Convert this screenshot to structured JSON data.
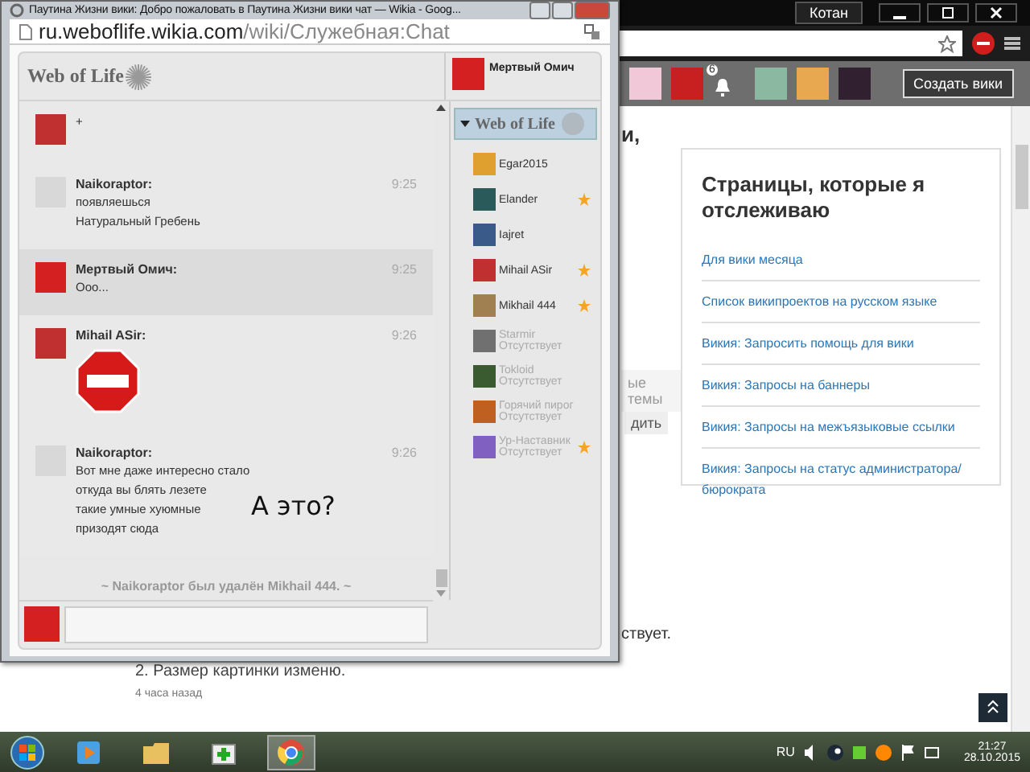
{
  "background_browser": {
    "profile_name": "Котан",
    "header_button": "Создать вики",
    "notification_count": "6",
    "fragments": [
      {
        "kind": "heading",
        "text": "и,"
      },
      {
        "kind": "tab",
        "text": "ые темы"
      },
      {
        "kind": "button",
        "text": "дить"
      },
      {
        "kind": "text",
        "text": "ствует."
      }
    ],
    "comment": {
      "text": "2. Размер картинки изменю.",
      "time": "4 часа назад"
    },
    "watchlist": {
      "title": "Страницы, которые я отслеживаю",
      "links": [
        "Для вики месяца",
        "Список википроектов на русском языке",
        "Викия: Запросить помощь для вики",
        "Викия: Запросы на баннеры",
        "Викия: Запросы на межъязыковые ссылки",
        "Викия: Запросы на статус администратора/ бюрократа"
      ]
    }
  },
  "chat_window": {
    "title": "Паутина Жизни вики: Добро пожаловать в Паутина Жизни вики чат — Wikia - Goog...",
    "url_host": "ru.weboflife.wikia.com",
    "url_path": "/wiki/Служебная:Chat",
    "logo": "Web of Life",
    "current_user": "Мертвый Омич",
    "messages": [
      {
        "kind": "text",
        "lines": [
          "+"
        ],
        "highlighted": false,
        "color": "#c03030"
      },
      {
        "kind": "text",
        "user": "Naikoraptor:",
        "time": "9:25",
        "lines": [
          "появляешься",
          "Натуральный Гребень"
        ],
        "highlighted": false,
        "color": "#d8d8d8"
      },
      {
        "kind": "text",
        "user": "Мертвый Омич:",
        "time": "9:25",
        "lines": [
          "Ооо..."
        ],
        "highlighted": true,
        "color": "#d42020"
      },
      {
        "kind": "image",
        "user": "Mihail ASir:",
        "time": "9:26",
        "highlighted": false,
        "color": "#c03030"
      },
      {
        "kind": "text",
        "user": "Naikoraptor:",
        "time": "9:26",
        "lines": [
          "Вот мне даже интересно стало",
          "откуда вы блять лезете",
          "такие умные хуюмные",
          "призодят сюда"
        ],
        "highlighted": false,
        "color": "#d8d8d8"
      }
    ],
    "notice": "~ Naikoraptor был удалён Mikhail 444. ~",
    "overlay_text": "А это?",
    "room": {
      "name": "Web of Life",
      "expanded": true,
      "users": [
        {
          "name": "Egar2015",
          "away": false,
          "star": false,
          "color": "#e0a030"
        },
        {
          "name": "Elander",
          "away": false,
          "star": true,
          "color": "#2a5a5a"
        },
        {
          "name": "Iajret",
          "away": false,
          "star": false,
          "color": "#3a5a8a"
        },
        {
          "name": "Mihail ASir",
          "away": false,
          "star": true,
          "color": "#c03030"
        },
        {
          "name": "Mikhail 444",
          "away": false,
          "star": true,
          "color": "#a08050"
        },
        {
          "name": "Starmir",
          "status": "Отсутствует",
          "away": true,
          "star": false,
          "color": "#707070"
        },
        {
          "name": "Tokloid",
          "status": "Отсутствует",
          "away": true,
          "star": false,
          "color": "#3a5a30"
        },
        {
          "name": "Горячий пирог",
          "status": "Отсутствует",
          "away": true,
          "star": false,
          "color": "#c06020"
        },
        {
          "name": "Ур-Наставник",
          "status": "Отсутствует",
          "away": true,
          "star": true,
          "color": "#8060c0"
        }
      ]
    }
  },
  "taskbar": {
    "language": "RU",
    "time": "21:27",
    "date": "28.10.2015"
  }
}
